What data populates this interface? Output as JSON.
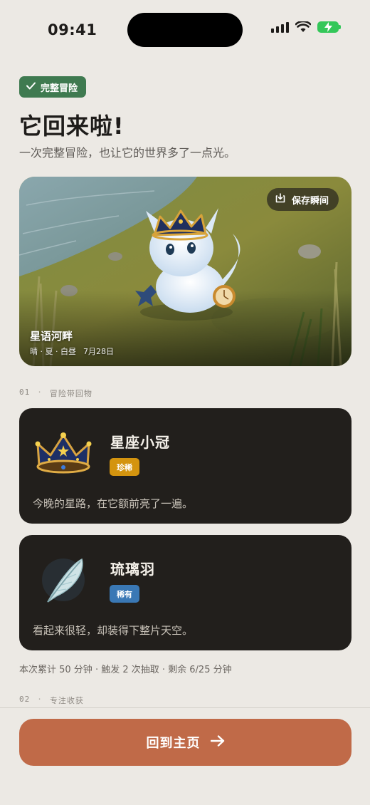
{
  "status_bar": {
    "time": "09:41"
  },
  "header": {
    "badge_label": "完整冒险",
    "title": "它回来啦!",
    "subtitle": "一次完整冒险，也让它的世界多了一点光。"
  },
  "hero": {
    "save_label": "保存瞬间",
    "location": "星语河畔",
    "conditions": "晴 · 夏 · 白昼",
    "date": "7月28日"
  },
  "section_items": {
    "index": "01",
    "title": "冒险带回物"
  },
  "items": [
    {
      "name": "星座小冠",
      "rarity": "珍稀",
      "rarity_color": "#d4940f",
      "description": "今晚的星路，在它额前亮了一遍。"
    },
    {
      "name": "琉璃羽",
      "rarity": "稀有",
      "rarity_color": "#3a78b5",
      "description": "看起来很轻，却装得下整片天空。"
    }
  ],
  "stats": "本次累计 50 分钟 · 触发 2 次抽取 · 剩余 6/25 分钟",
  "section_focus": {
    "index": "02",
    "title": "专注收获"
  },
  "footer": {
    "home_label": "回到主页"
  }
}
